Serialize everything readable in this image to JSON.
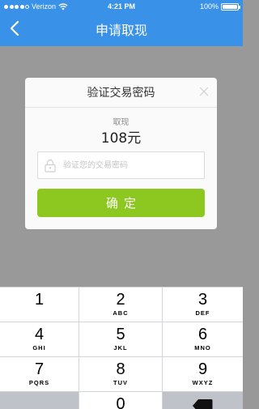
{
  "status_bar": {
    "carrier": "Verizon",
    "time": "4:21 PM",
    "battery": "100%",
    "signal_dots": 5,
    "signal_filled": 4,
    "battery_level": 1.0
  },
  "nav": {
    "title": "申请取现",
    "back_icon": "chevron-left-icon"
  },
  "colors": {
    "nav_background": "#3a92e8",
    "overlay": "#999999",
    "confirm_button": "#8cc81f"
  },
  "dialog": {
    "title": "验证交易密码",
    "close_icon": "close-icon",
    "amount_label": "取现",
    "amount": "108元",
    "password_placeholder": "验证您的交易密码",
    "password_value": "",
    "lock_icon": "lock-icon",
    "confirm_label": "确定"
  },
  "keypad": {
    "keys": [
      {
        "num": "1",
        "letters": ""
      },
      {
        "num": "2",
        "letters": "ABC"
      },
      {
        "num": "3",
        "letters": "DEF"
      },
      {
        "num": "4",
        "letters": "GHI"
      },
      {
        "num": "5",
        "letters": "JKL"
      },
      {
        "num": "6",
        "letters": "MNO"
      },
      {
        "num": "7",
        "letters": "PQRS"
      },
      {
        "num": "8",
        "letters": "TUV"
      },
      {
        "num": "9",
        "letters": "WXYZ"
      },
      {
        "num": "0",
        "letters": ""
      }
    ],
    "delete_icon": "backspace-icon"
  }
}
